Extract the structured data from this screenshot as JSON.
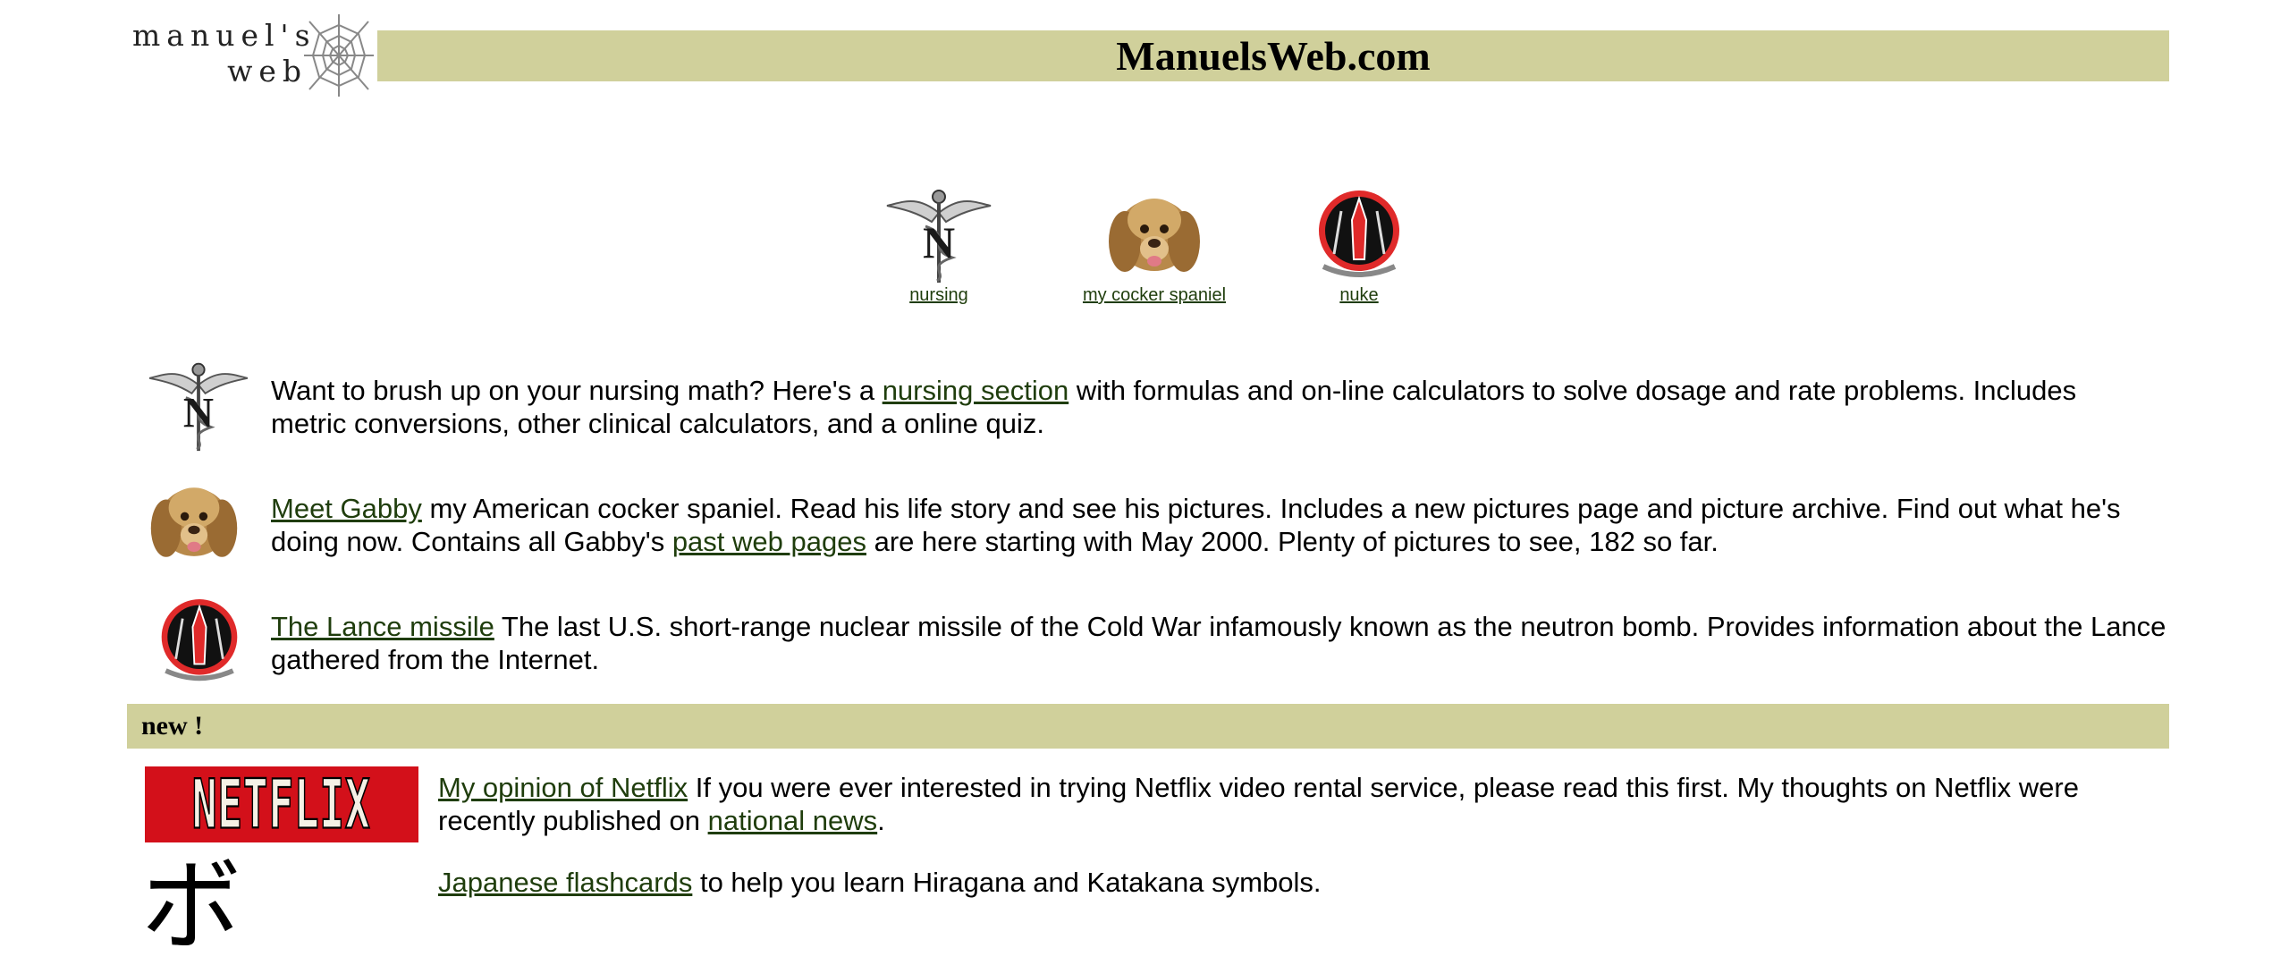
{
  "header": {
    "logo_text_line1": "manuel's",
    "logo_text_line2": "web",
    "site_title": "ManuelsWeb.com"
  },
  "nav": [
    {
      "label": "nursing",
      "icon": "nursing-caduceus-icon"
    },
    {
      "label": "my cocker spaniel",
      "icon": "dog-icon"
    },
    {
      "label": "nuke",
      "icon": "nuke-insignia-icon"
    }
  ],
  "rows": {
    "nursing": {
      "text_before": "Want to brush up on your nursing math?  Here's a ",
      "link": "nursing section",
      "text_after": " with formulas and on-line calculators to solve dosage and rate problems.  Includes metric conversions, other clinical calculators, and a online quiz."
    },
    "gabby": {
      "link": "Meet Gabby",
      "text_mid": " my American cocker spaniel.  Read his life story and see his pictures.  Includes a new pictures page and picture archive.  Find out what he's doing now.  Contains all Gabby's ",
      "link2": "past web pages",
      "text_after": " are here starting with May 2000.  Plenty of pictures to see, 182 so far."
    },
    "lance": {
      "link": "The Lance missile",
      "text_after": " The last U.S. short-range nuclear missile of the Cold War infamously known as the neutron bomb. Provides information about the Lance gathered from the Internet."
    }
  },
  "new_section": {
    "label": "new !",
    "netflix": {
      "logo_text": "NETFLIX",
      "link": "My opinion of Netflix",
      "text_mid": "  If you were ever interested in trying Netflix video rental service, please read this first.  My thoughts on Netflix were recently published on ",
      "link2": "national news",
      "text_after": "."
    },
    "japanese": {
      "glyph": "ボ",
      "link": "Japanese flashcards",
      "text_after": " to help you learn Hiragana and Katakana symbols."
    }
  },
  "colors": {
    "bar": "#d0d09b",
    "link": "#1f3d0c",
    "netflix_red": "#d3101a"
  }
}
